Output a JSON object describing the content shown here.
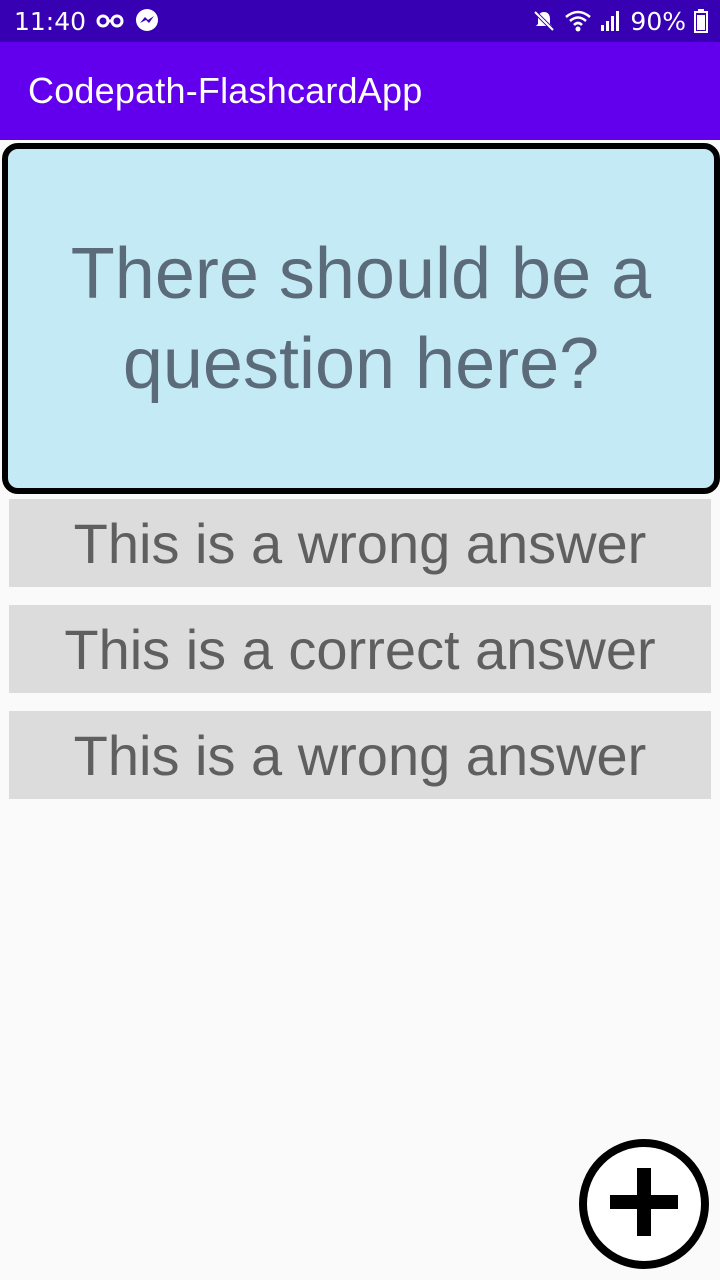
{
  "status_bar": {
    "time": "11:40",
    "battery": "90%",
    "icons": [
      "incognito-icon",
      "messenger-icon",
      "mute-icon",
      "wifi-icon",
      "signal-icon",
      "battery-icon"
    ]
  },
  "app_bar": {
    "title": "Codepath-FlashcardApp",
    "color": "#6200ee"
  },
  "flashcard": {
    "question": "There should be a question here?",
    "background": "#c4ebf5"
  },
  "answers": [
    {
      "label": "This is a wrong answer"
    },
    {
      "label": "This is a correct answer"
    },
    {
      "label": "This is a wrong answer"
    }
  ],
  "fab": {
    "icon": "add-icon"
  }
}
